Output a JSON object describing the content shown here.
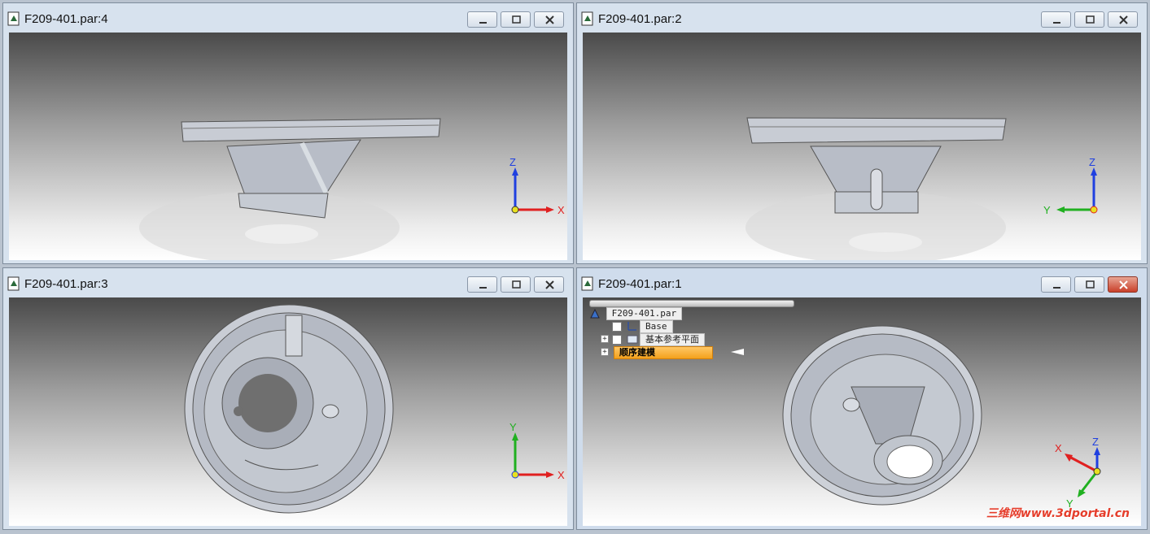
{
  "windows": [
    {
      "title": "F209-401.par:4"
    },
    {
      "title": "F209-401.par:2"
    },
    {
      "title": "F209-401.par:3"
    },
    {
      "title": "F209-401.par:1"
    }
  ],
  "tree": {
    "root": "F209-401.par",
    "items": [
      "Base",
      "基本参考平面",
      "顺序建模"
    ]
  },
  "axes": {
    "x": "X",
    "y": "Y",
    "z": "Z"
  },
  "watermark": "三维网www.3dportal.cn",
  "colors": {
    "x_axis": "#e02020",
    "y_axis": "#20b020",
    "z_axis": "#2040e0",
    "selected_tree": "#f4a11c"
  }
}
